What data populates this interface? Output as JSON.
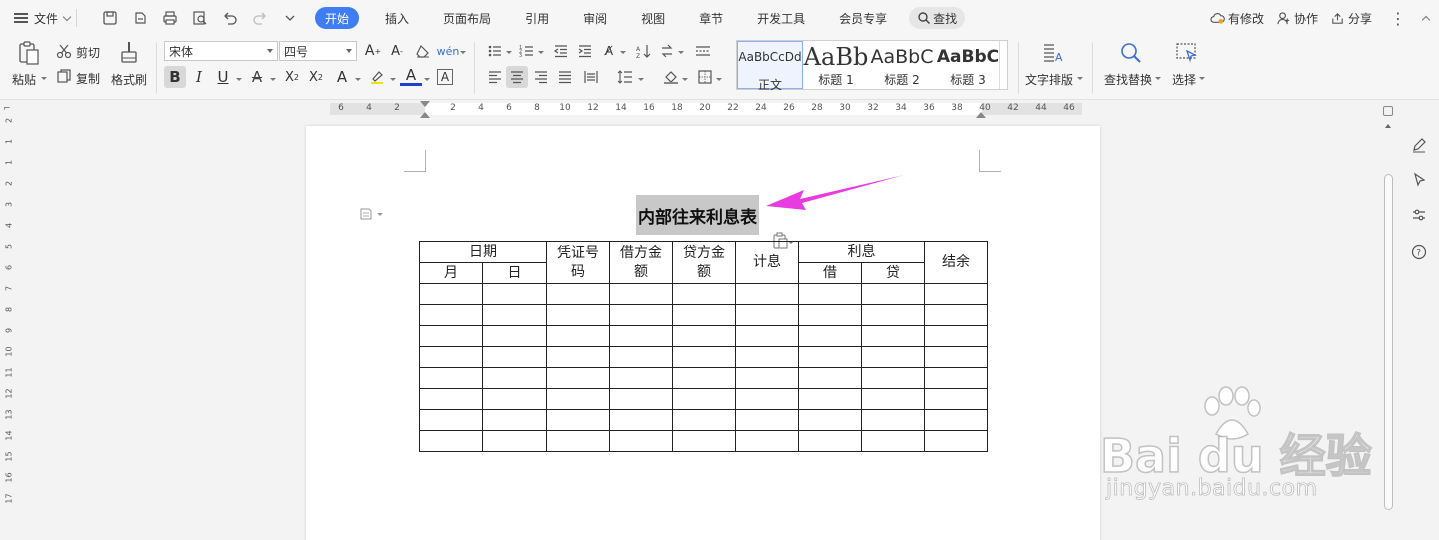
{
  "menubar": {
    "file_label": "文件",
    "tabs": [
      {
        "label": "开始",
        "active": true
      },
      {
        "label": "插入"
      },
      {
        "label": "页面布局"
      },
      {
        "label": "引用"
      },
      {
        "label": "审阅"
      },
      {
        "label": "视图"
      },
      {
        "label": "章节"
      },
      {
        "label": "开发工具"
      },
      {
        "label": "会员专享"
      }
    ],
    "search_label": "查找",
    "right": {
      "modified": "有修改",
      "collab": "协作",
      "share": "分享"
    },
    "accent_color": "#3f7df4"
  },
  "ribbon": {
    "paste": "粘贴",
    "cut": "剪切",
    "copy": "复制",
    "format_painter": "格式刷",
    "font_name": "宋体",
    "font_size": "四号",
    "styles": [
      {
        "sample": "AaBbCcDd",
        "name": "正文",
        "active": true
      },
      {
        "sample": "AaBb",
        "name": "标题 1"
      },
      {
        "sample": "AaBbC",
        "name": "标题 2"
      },
      {
        "sample": "AaBbC",
        "name": "标题 3"
      }
    ],
    "text_layout": "文字排版",
    "find_replace": "查找替换",
    "select": "选择"
  },
  "ruler": {
    "left_ticks": [
      "6",
      "4",
      "2"
    ],
    "right_ticks": [
      "2",
      "4",
      "6",
      "8",
      "10",
      "12",
      "14",
      "16",
      "18",
      "20",
      "22",
      "24",
      "26",
      "28",
      "30",
      "32",
      "34",
      "36",
      "38",
      "40",
      "42",
      "44",
      "46"
    ],
    "vertical_ticks": [
      "2",
      "1",
      "1",
      "2",
      "3",
      "4",
      "5",
      "6",
      "7",
      "8",
      "9",
      "10",
      "11",
      "12",
      "13",
      "14",
      "15",
      "16",
      "17"
    ]
  },
  "document": {
    "title": "内部往来利息表",
    "table": {
      "h_date": "日期",
      "h_voucher_a": "凭证号",
      "h_voucher_b": "码",
      "h_debit_a": "借方金",
      "h_debit_b": "额",
      "h_credit_a": "贷方金",
      "h_credit_b": "额",
      "h_interest_calc": "计息",
      "h_interest": "利息",
      "h_balance": "结余",
      "h_month": "月",
      "h_day": "日",
      "h_borrow": "借",
      "h_lend": "贷"
    },
    "arrow_color": "#e83be0"
  },
  "watermark": {
    "main": "Bai du 经验",
    "sub": "jingyan.baidu.com"
  }
}
